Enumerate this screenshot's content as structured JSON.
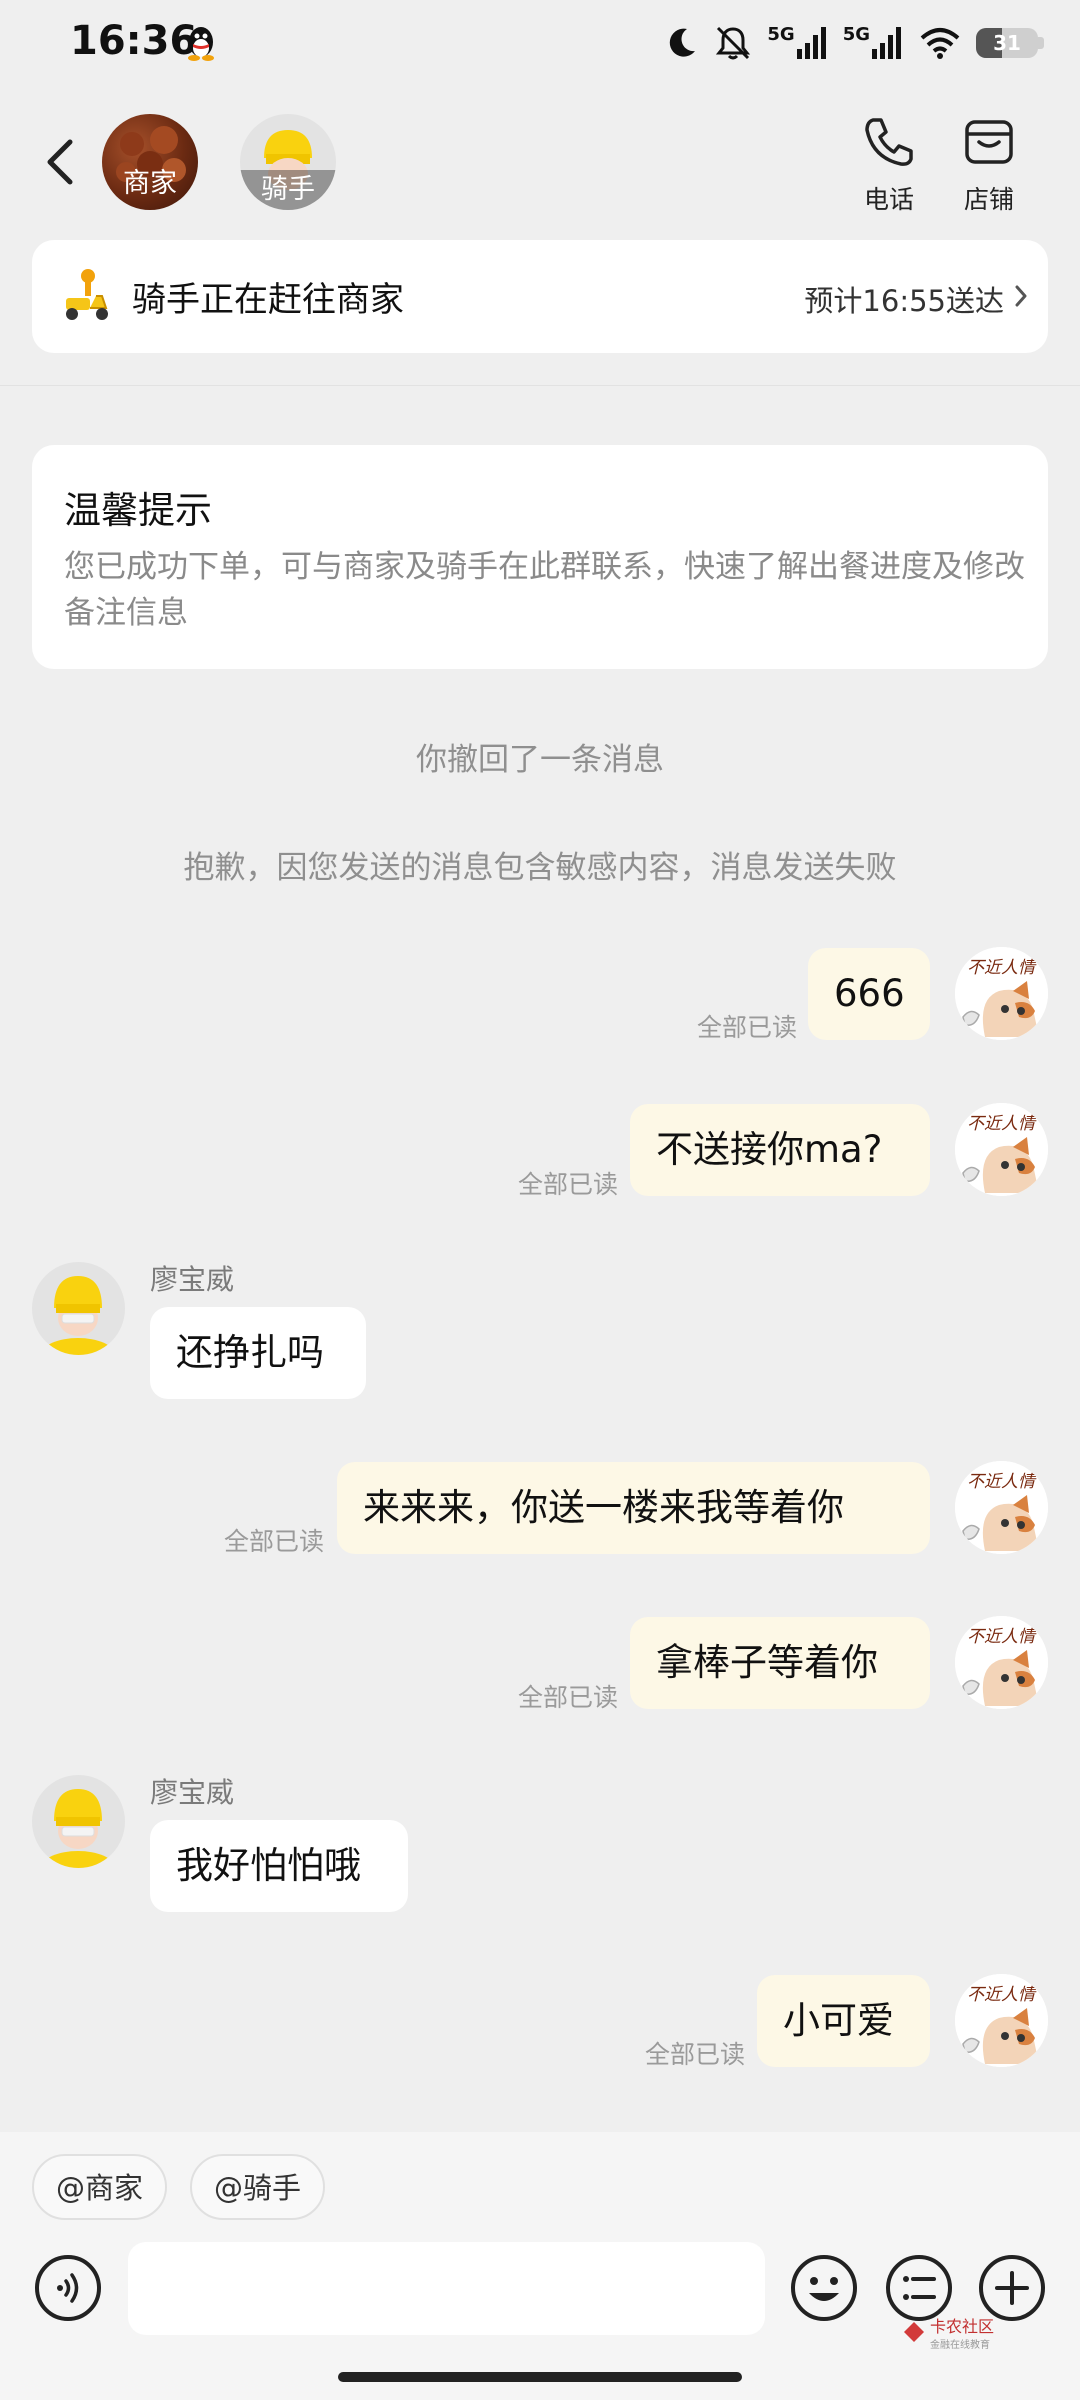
{
  "status_bar": {
    "time": "16:36",
    "network_1": "5G",
    "network_2": "5G",
    "battery": "31"
  },
  "header": {
    "merchant_label": "商家",
    "rider_label": "骑手",
    "phone_label": "电话",
    "store_label": "店铺"
  },
  "delivery": {
    "status": "骑手正在赶往商家",
    "eta": "预计16:55送达"
  },
  "tip": {
    "title": "温馨提示",
    "body": "您已成功下单，可与商家及骑手在此群联系，快速了解出餐进度及修改备注信息"
  },
  "system_messages": {
    "recalled": "你撤回了一条消息",
    "failed": "抱歉，因您发送的消息包含敏感内容，消息发送失败"
  },
  "messages": [
    {
      "from": "me",
      "text": "666",
      "read": "全部已读"
    },
    {
      "from": "me",
      "text": "不送接你ma?",
      "read": "全部已读"
    },
    {
      "from": "rider",
      "sender": "廖宝威",
      "text": "还挣扎吗"
    },
    {
      "from": "me",
      "text": "来来来，你送一楼来我等着你",
      "read": "全部已读"
    },
    {
      "from": "me",
      "text": "拿棒子等着你",
      "read": "全部已读"
    },
    {
      "from": "rider",
      "sender": "廖宝威",
      "text": "我好怕怕哦"
    },
    {
      "from": "me",
      "text": "小可爱",
      "read": "全部已读"
    }
  ],
  "self_avatar_text": "不近人情",
  "bottom": {
    "mention_merchant": "@商家",
    "mention_rider": "@骑手",
    "input_value": ""
  },
  "watermark": {
    "line1": "卡农社区",
    "line2": "金融在线教育"
  },
  "colors": {
    "background": "#efefef",
    "my_bubble": "#fdf8e6",
    "rider_helmet": "#f9d20f"
  }
}
